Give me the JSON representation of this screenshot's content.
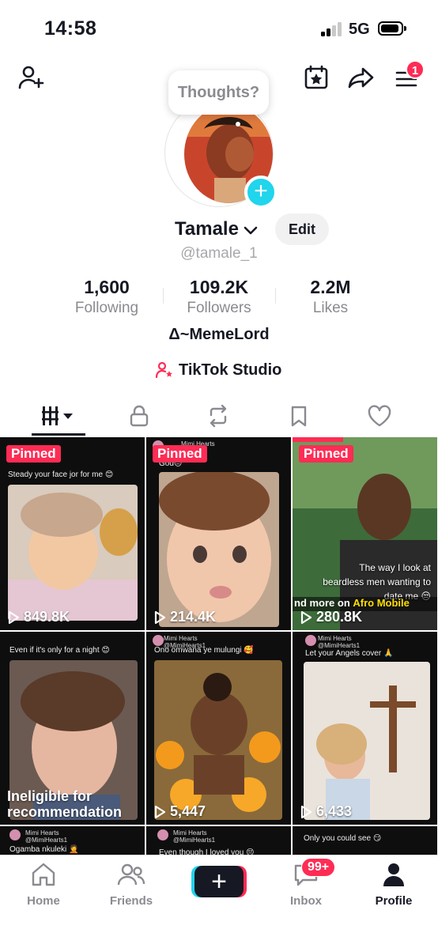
{
  "status_bar": {
    "time": "14:58",
    "network": "5G"
  },
  "top_nav": {
    "add_friend_icon": "person-add-icon",
    "calendar_icon": "calendar-star-icon",
    "share_icon": "share-icon",
    "menu_icon": "menu-icon",
    "menu_badge": "1"
  },
  "profile": {
    "bubble_text": "Thoughts?",
    "display_name": "Tamale",
    "edit_label": "Edit",
    "username": "@tamale_1",
    "stats": [
      {
        "value": "1,600",
        "label": "Following"
      },
      {
        "value": "109.2K",
        "label": "Followers"
      },
      {
        "value": "2.2M",
        "label": "Likes"
      }
    ],
    "bio": "Δ~MemeLord",
    "studio_label": "TikTok Studio"
  },
  "tabs": [
    "videos-grid",
    "private",
    "reposts",
    "saved",
    "liked"
  ],
  "videos": [
    {
      "pinned": "Pinned",
      "caption": "Steady your face jor for me 😊",
      "views": "849.8K"
    },
    {
      "pinned": "Pinned",
      "user": "Mimi Hearts",
      "caption": "God😔",
      "views": "214.4K"
    },
    {
      "pinned": "Pinned",
      "overlay": [
        "The way I look at",
        "beardless men wanting to",
        "date me 😒"
      ],
      "ticker_prefix": "nd more on ",
      "ticker_brand": "Afro Mobile",
      "views": "280.8K"
    },
    {
      "caption": "Even if it's only for a night 😊",
      "ineligible": "Ineligible for recommendation"
    },
    {
      "user": "Mimi Hearts",
      "handle": "@MimiHearts1",
      "caption": "Ono omwana ye mulungi 🥰",
      "views": "5,447"
    },
    {
      "user": "Mimi Hearts",
      "handle": "@MimiHearts1",
      "caption": "Let your Angels cover 🙏",
      "views": "6,433"
    },
    {
      "user": "Mimi Hearts",
      "handle": "@MimiHearts1",
      "caption": "Ogamba nkuleki 🤦"
    },
    {
      "user": "Mimi Hearts",
      "handle": "@MimiHearts1",
      "caption": "Even though I loved you 😔"
    },
    {
      "caption": "Only you could see 😏"
    }
  ],
  "bottom_nav": {
    "home": "Home",
    "friends": "Friends",
    "inbox": "Inbox",
    "inbox_badge": "99+",
    "profile": "Profile"
  },
  "colors": {
    "accent_red": "#fe2c55",
    "accent_cyan": "#20d5ec",
    "text": "#161823"
  }
}
